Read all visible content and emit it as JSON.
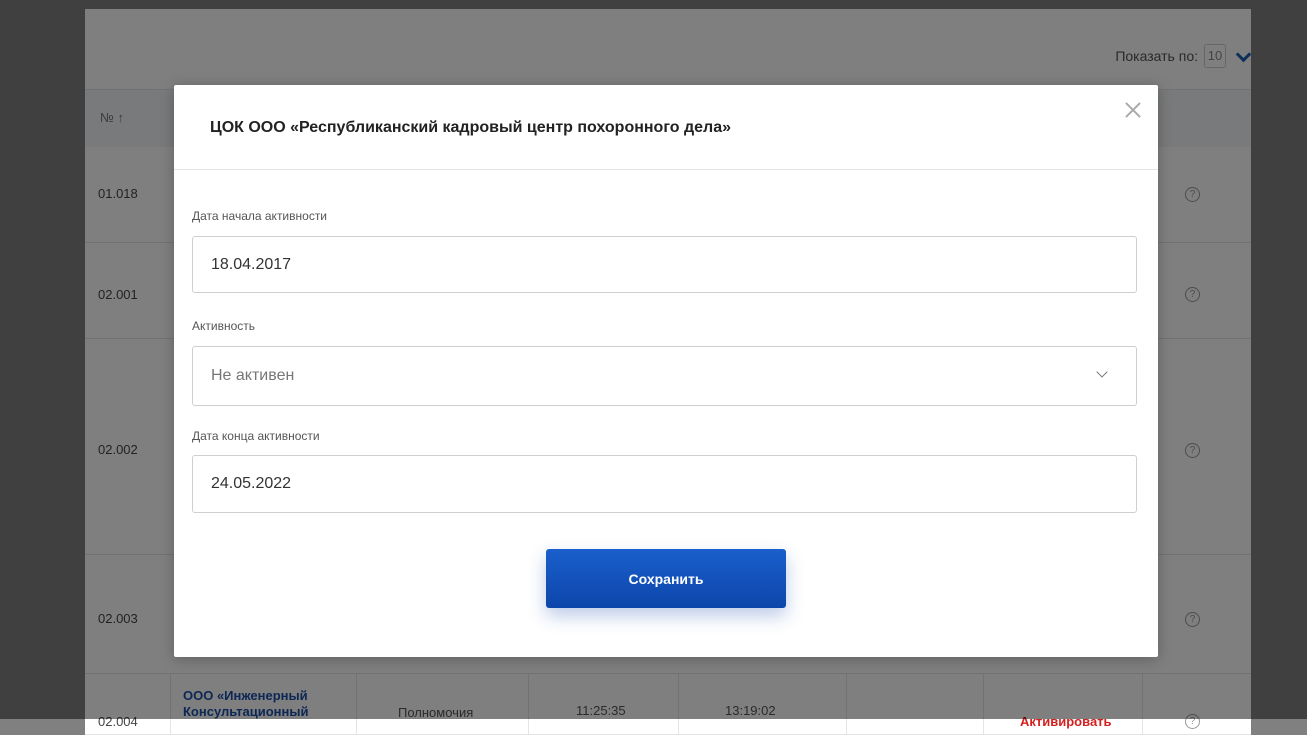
{
  "background": {
    "page_size_label": "Показать по:",
    "page_size_value": "10",
    "table": {
      "num_header": "№ ↑",
      "rows": [
        {
          "num": "01.018"
        },
        {
          "num": "02.001"
        },
        {
          "num": "02.002"
        },
        {
          "num": "02.003"
        },
        {
          "num": "02.004",
          "org": "ООО «Инженерный Консультационный",
          "type": "Полномочия",
          "time_start": "11:25:35",
          "time_end": "13:19:02",
          "action": "Активировать"
        }
      ]
    }
  },
  "modal": {
    "title": "ЦОК ООО «Республиканский кадровый центр похоронного дела»",
    "start_date": {
      "label": "Дата начала активности",
      "value": "18.04.2017"
    },
    "activity": {
      "label": "Активность",
      "value": "Не активен"
    },
    "end_date": {
      "label": "Дата конца активности",
      "value": "24.05.2022"
    },
    "save_label": "Сохранить"
  },
  "colors": {
    "primary_button": "#0d46aa",
    "link_blue": "#1a4ea8",
    "danger_red": "#d32020",
    "overlay": "rgba(0,0,0,0.5)"
  }
}
